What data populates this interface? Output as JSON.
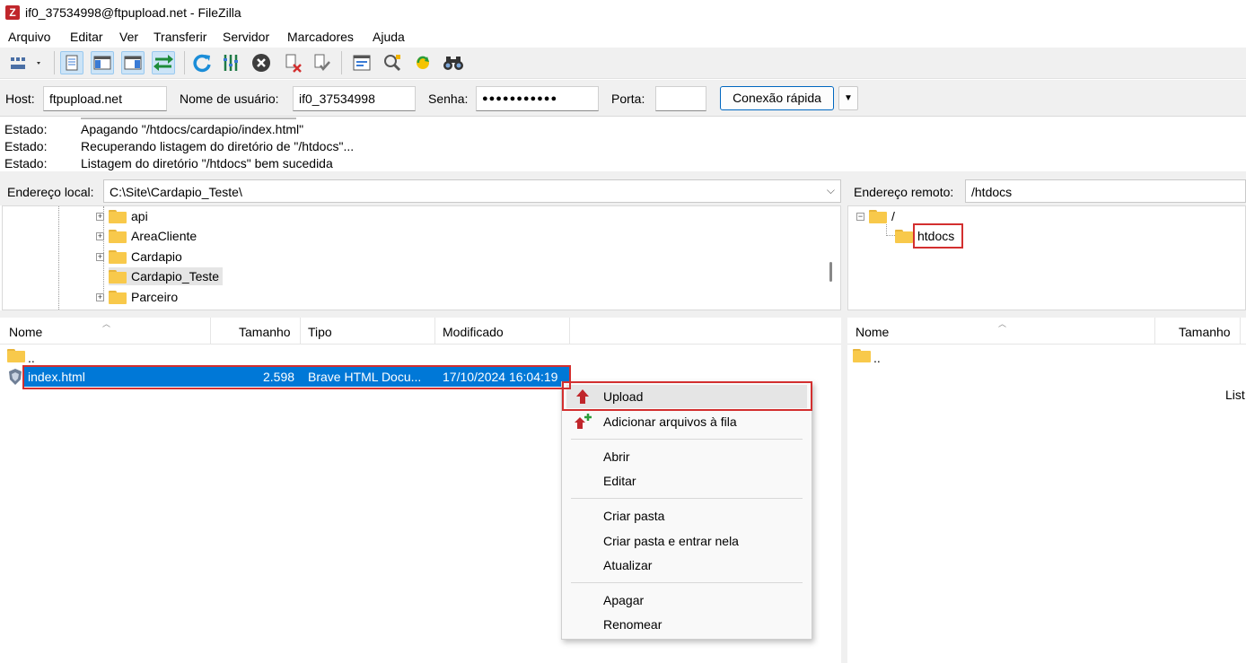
{
  "window": {
    "title": "if0_37534998@ftpupload.net - FileZilla"
  },
  "menu": [
    "Arquivo",
    "Editar",
    "Ver",
    "Transferir",
    "Servidor",
    "Marcadores",
    "Ajuda"
  ],
  "quickconnect": {
    "host_label": "Host:",
    "host_value": "ftpupload.net",
    "user_label": "Nome de usuário:",
    "user_value": "if0_37534998",
    "pass_label": "Senha:",
    "pass_value": "●●●●●●●●●●●",
    "port_label": "Porta:",
    "port_value": "",
    "connect_button": "Conexão rápida"
  },
  "log": [
    {
      "key": "Estado:",
      "msg": "Apagando \"/htdocs/cardapio/index.html\""
    },
    {
      "key": "Estado:",
      "msg": "Recuperando listagem do diretório de \"/htdocs\"..."
    },
    {
      "key": "Estado:",
      "msg": "Listagem do diretório \"/htdocs\" bem sucedida"
    }
  ],
  "local": {
    "address_label": "Endereço local:",
    "address_value": "C:\\Site\\Cardapio_Teste\\",
    "tree": [
      "api",
      "AreaCliente",
      "Cardapio",
      "Cardapio_Teste",
      "Parceiro"
    ],
    "columns": {
      "name": "Nome",
      "size": "Tamanho",
      "type": "Tipo",
      "modified": "Modificado"
    },
    "files": [
      {
        "name": "..",
        "size": "",
        "type": "",
        "modified": ""
      },
      {
        "name": "index.html",
        "size": "2.598",
        "type": "Brave HTML Docu...",
        "modified": "17/10/2024 16:04:19"
      }
    ]
  },
  "remote": {
    "address_label": "Endereço remoto:",
    "address_value": "/htdocs",
    "tree": [
      "/",
      "htdocs"
    ],
    "columns": {
      "name": "Nome",
      "size": "Tamanho"
    },
    "files": [
      {
        "name": ".."
      }
    ],
    "partial_text": "List"
  },
  "context_menu": {
    "upload": "Upload",
    "add_queue": "Adicionar arquivos à fila",
    "open": "Abrir",
    "edit": "Editar",
    "mkdir": "Criar pasta",
    "mkdir_enter": "Criar pasta e entrar nela",
    "refresh": "Atualizar",
    "delete": "Apagar",
    "rename": "Renomear"
  },
  "colors": {
    "selection": "#0078d7",
    "highlight": "#d32f2f",
    "accent": "#0067c0"
  }
}
